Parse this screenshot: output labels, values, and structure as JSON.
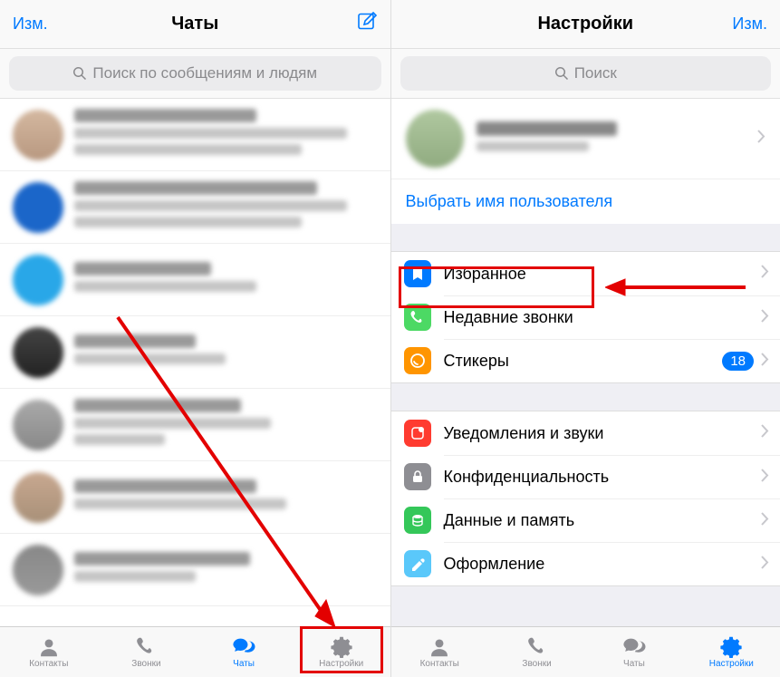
{
  "left": {
    "header": {
      "edit": "Изм.",
      "title": "Чаты"
    },
    "search_placeholder": "Поиск по сообщениям и людям",
    "tabs": {
      "contacts": "Контакты",
      "calls": "Звонки",
      "chats": "Чаты",
      "settings": "Настройки"
    }
  },
  "right": {
    "header": {
      "title": "Настройки",
      "edit": "Изм."
    },
    "search_placeholder": "Поиск",
    "username_action": "Выбрать имя пользователя",
    "section1": {
      "favorites": "Избранное",
      "recent_calls": "Недавние звонки",
      "stickers": "Стикеры",
      "stickers_badge": "18"
    },
    "section2": {
      "notifications": "Уведомления и звуки",
      "privacy": "Конфиденциальность",
      "data": "Данные и память",
      "appearance": "Оформление"
    },
    "tabs": {
      "contacts": "Контакты",
      "calls": "Звонки",
      "chats": "Чаты",
      "settings": "Настройки"
    }
  }
}
